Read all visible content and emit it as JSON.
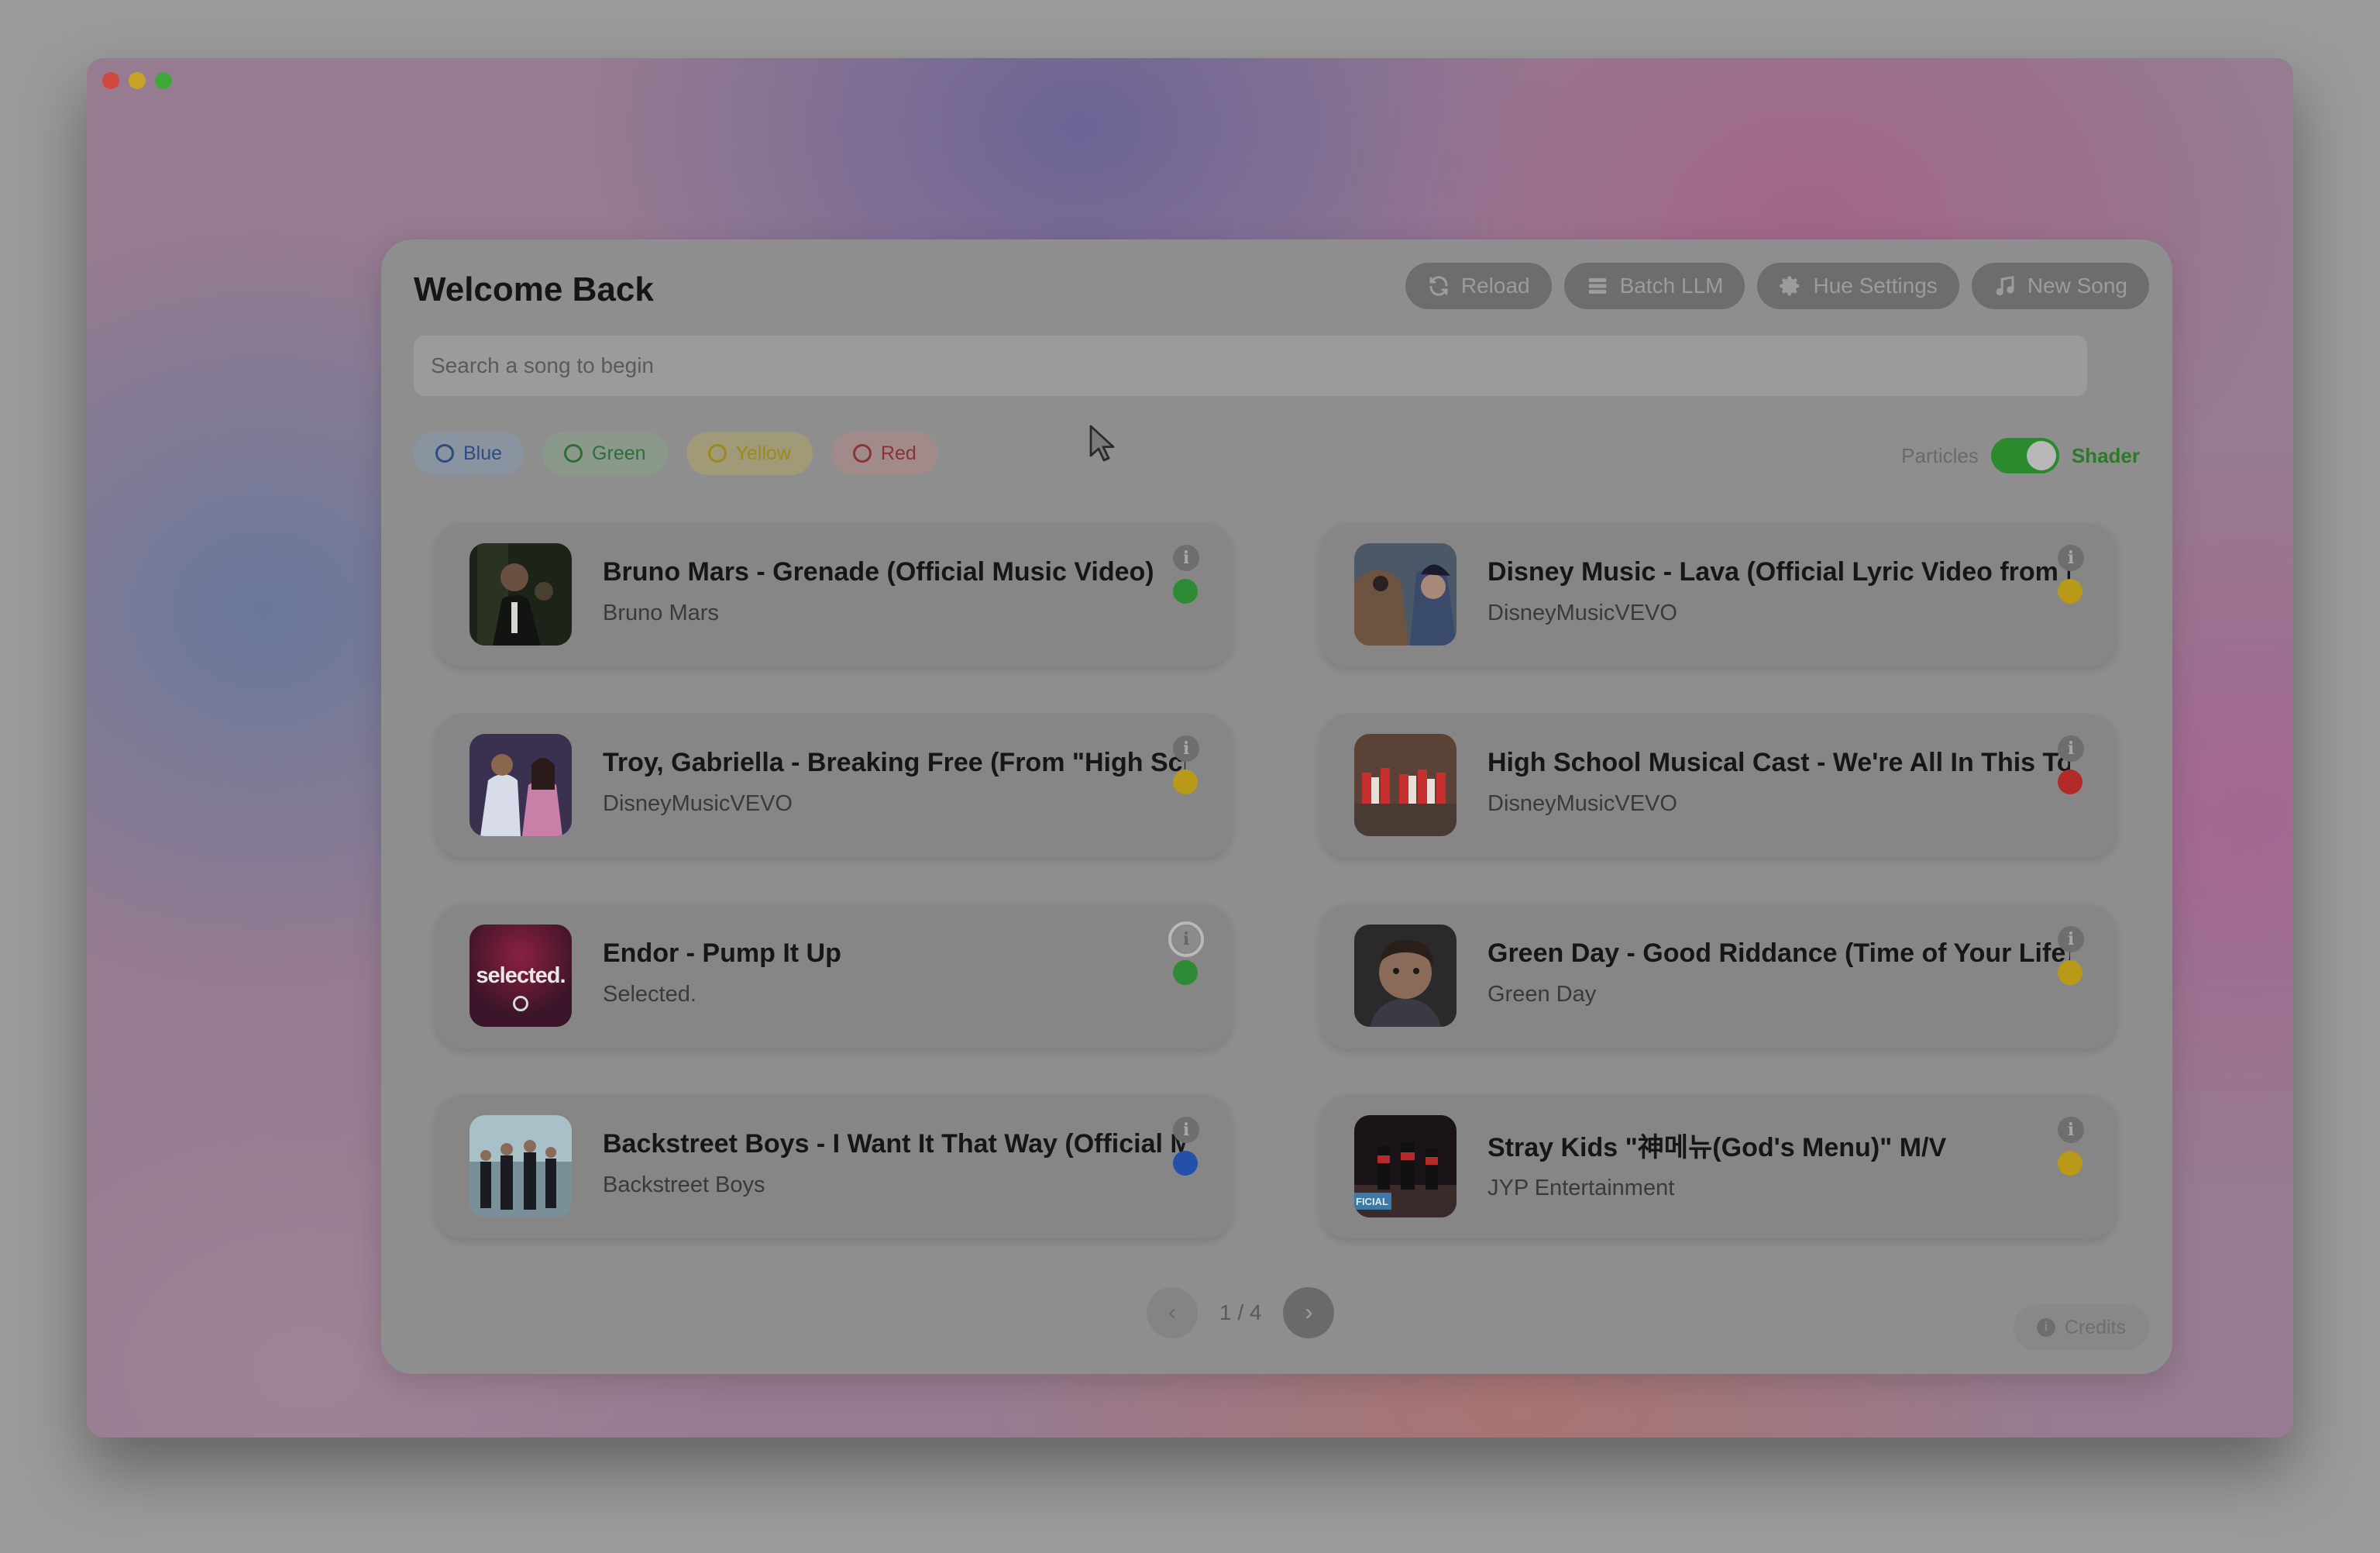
{
  "panel": {
    "title": "Welcome Back",
    "toolbar": [
      {
        "label": "Reload",
        "icon": "refresh-icon"
      },
      {
        "label": "Batch LLM",
        "icon": "stack-icon"
      },
      {
        "label": "Hue Settings",
        "icon": "gear-icon"
      },
      {
        "label": "New Song",
        "icon": "music-note-icon"
      }
    ],
    "search_placeholder": "Search a song to begin",
    "filters": [
      {
        "label": "Blue",
        "color": "#2e4c80"
      },
      {
        "label": "Green",
        "color": "#2e6e34"
      },
      {
        "label": "Yellow",
        "color": "#9b8a1a"
      },
      {
        "label": "Red",
        "color": "#8a3434"
      }
    ],
    "mode": {
      "left_label": "Particles",
      "right_label": "Shader",
      "state": "Shader"
    }
  },
  "songs": [
    {
      "title": "Bruno Mars - Grenade (Official Music Video)",
      "artist": "Bruno Mars",
      "color": "green"
    },
    {
      "title": "Disney Music - Lava (Official Lyric Video from Lava)",
      "artist": "DisneyMusicVEVO",
      "color": "yellow"
    },
    {
      "title": "Troy, Gabriella - Breaking Free (From \"High School Musical\")",
      "artist": "DisneyMusicVEVO",
      "color": "yellow"
    },
    {
      "title": "High School Musical Cast - We're All In This Together",
      "artist": "DisneyMusicVEVO",
      "color": "red"
    },
    {
      "title": "Endor - Pump It Up",
      "artist": "Selected.",
      "color": "green"
    },
    {
      "title": "Green Day - Good Riddance (Time of Your Life)",
      "artist": "Green Day",
      "color": "yellow"
    },
    {
      "title": "Backstreet Boys - I Want It That Way (Official Music Video)",
      "artist": "Backstreet Boys",
      "color": "blue"
    },
    {
      "title": "Stray Kids \"神메뉴(God's Menu)\" M/V",
      "artist": "JYP Entertainment",
      "color": "yellow"
    }
  ],
  "thumb_texts": {
    "selected": "selected.",
    "official": "FICIAL"
  },
  "pagination": {
    "text": "1 / 4",
    "prev": "‹",
    "next": "›"
  },
  "credits_label": "Credits",
  "colors": {
    "green": "#2e8b35",
    "yellow": "#b89a18",
    "red": "#b32a2a",
    "blue": "#2350a8",
    "toggle_on": "#2c8a2e"
  }
}
